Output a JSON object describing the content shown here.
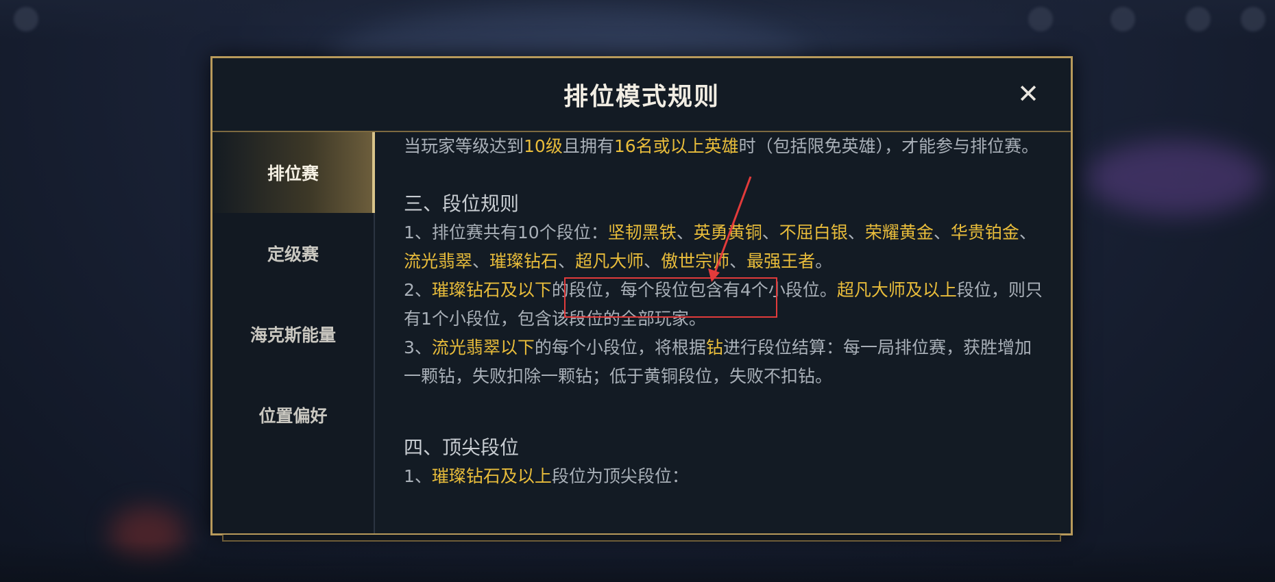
{
  "modal": {
    "title": "排位模式规则",
    "close_label": "✕"
  },
  "sidebar": {
    "items": [
      {
        "label": "排位赛",
        "active": true
      },
      {
        "label": "定级赛",
        "active": false
      },
      {
        "label": "海克斯能量",
        "active": false
      },
      {
        "label": "位置偏好",
        "active": false
      }
    ]
  },
  "content": {
    "intro": {
      "t1": "当玩家等级达到",
      "g1": "10级",
      "t2": "且拥有",
      "g2": "16名或以上英雄",
      "t3": "时（包括限免英雄），才能参与排位赛。"
    },
    "section3_title": "三、段位规则",
    "rule1": {
      "t1": "1、排位赛共有10个段位：",
      "ranks": [
        "坚韧黑铁",
        "英勇黄铜",
        "不屈白银",
        "荣耀黄金",
        "华贵铂金",
        "流光翡翠",
        "璀璨钻石",
        "超凡大师",
        "傲世宗师",
        "最强王者"
      ],
      "sep": "、",
      "end": "。"
    },
    "rule2": {
      "t1": "2、",
      "g1": "璀璨钻石及以下",
      "t2": "的段位，每个段位包含有4个小段位。",
      "g2": "超凡大师及以上",
      "t3": "段位，则只有1个小段位，包含该段位的全部玩家。"
    },
    "rule3": {
      "t1": "3、",
      "g1": "流光翡翠以下",
      "t2": "的每个小段位，将根据",
      "g2": "钻",
      "t3": "进行段位结算：每一局排位赛，获胜增加一颗钻，失败扣除一颗钻；低于黄铜段位，失败不扣钻。"
    },
    "section4_title": "四、顶尖段位",
    "rule4": {
      "t1": "1、",
      "g1": "璀璨钻石及以上",
      "t2": "段位为顶尖段位："
    }
  },
  "colors": {
    "gold_text": "#e9bd3b",
    "frame_gold": "#b89a5b",
    "annotation_red": "#e23b3b"
  }
}
